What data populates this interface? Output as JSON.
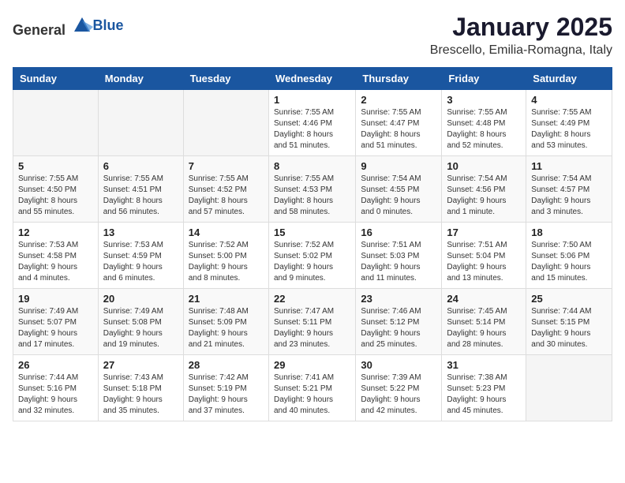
{
  "logo": {
    "text_general": "General",
    "text_blue": "Blue"
  },
  "header": {
    "month": "January 2025",
    "location": "Brescello, Emilia-Romagna, Italy"
  },
  "weekdays": [
    "Sunday",
    "Monday",
    "Tuesday",
    "Wednesday",
    "Thursday",
    "Friday",
    "Saturday"
  ],
  "weeks": [
    [
      {
        "day": "",
        "info": ""
      },
      {
        "day": "",
        "info": ""
      },
      {
        "day": "",
        "info": ""
      },
      {
        "day": "1",
        "info": "Sunrise: 7:55 AM\nSunset: 4:46 PM\nDaylight: 8 hours\nand 51 minutes."
      },
      {
        "day": "2",
        "info": "Sunrise: 7:55 AM\nSunset: 4:47 PM\nDaylight: 8 hours\nand 51 minutes."
      },
      {
        "day": "3",
        "info": "Sunrise: 7:55 AM\nSunset: 4:48 PM\nDaylight: 8 hours\nand 52 minutes."
      },
      {
        "day": "4",
        "info": "Sunrise: 7:55 AM\nSunset: 4:49 PM\nDaylight: 8 hours\nand 53 minutes."
      }
    ],
    [
      {
        "day": "5",
        "info": "Sunrise: 7:55 AM\nSunset: 4:50 PM\nDaylight: 8 hours\nand 55 minutes."
      },
      {
        "day": "6",
        "info": "Sunrise: 7:55 AM\nSunset: 4:51 PM\nDaylight: 8 hours\nand 56 minutes."
      },
      {
        "day": "7",
        "info": "Sunrise: 7:55 AM\nSunset: 4:52 PM\nDaylight: 8 hours\nand 57 minutes."
      },
      {
        "day": "8",
        "info": "Sunrise: 7:55 AM\nSunset: 4:53 PM\nDaylight: 8 hours\nand 58 minutes."
      },
      {
        "day": "9",
        "info": "Sunrise: 7:54 AM\nSunset: 4:55 PM\nDaylight: 9 hours\nand 0 minutes."
      },
      {
        "day": "10",
        "info": "Sunrise: 7:54 AM\nSunset: 4:56 PM\nDaylight: 9 hours\nand 1 minute."
      },
      {
        "day": "11",
        "info": "Sunrise: 7:54 AM\nSunset: 4:57 PM\nDaylight: 9 hours\nand 3 minutes."
      }
    ],
    [
      {
        "day": "12",
        "info": "Sunrise: 7:53 AM\nSunset: 4:58 PM\nDaylight: 9 hours\nand 4 minutes."
      },
      {
        "day": "13",
        "info": "Sunrise: 7:53 AM\nSunset: 4:59 PM\nDaylight: 9 hours\nand 6 minutes."
      },
      {
        "day": "14",
        "info": "Sunrise: 7:52 AM\nSunset: 5:00 PM\nDaylight: 9 hours\nand 8 minutes."
      },
      {
        "day": "15",
        "info": "Sunrise: 7:52 AM\nSunset: 5:02 PM\nDaylight: 9 hours\nand 9 minutes."
      },
      {
        "day": "16",
        "info": "Sunrise: 7:51 AM\nSunset: 5:03 PM\nDaylight: 9 hours\nand 11 minutes."
      },
      {
        "day": "17",
        "info": "Sunrise: 7:51 AM\nSunset: 5:04 PM\nDaylight: 9 hours\nand 13 minutes."
      },
      {
        "day": "18",
        "info": "Sunrise: 7:50 AM\nSunset: 5:06 PM\nDaylight: 9 hours\nand 15 minutes."
      }
    ],
    [
      {
        "day": "19",
        "info": "Sunrise: 7:49 AM\nSunset: 5:07 PM\nDaylight: 9 hours\nand 17 minutes."
      },
      {
        "day": "20",
        "info": "Sunrise: 7:49 AM\nSunset: 5:08 PM\nDaylight: 9 hours\nand 19 minutes."
      },
      {
        "day": "21",
        "info": "Sunrise: 7:48 AM\nSunset: 5:09 PM\nDaylight: 9 hours\nand 21 minutes."
      },
      {
        "day": "22",
        "info": "Sunrise: 7:47 AM\nSunset: 5:11 PM\nDaylight: 9 hours\nand 23 minutes."
      },
      {
        "day": "23",
        "info": "Sunrise: 7:46 AM\nSunset: 5:12 PM\nDaylight: 9 hours\nand 25 minutes."
      },
      {
        "day": "24",
        "info": "Sunrise: 7:45 AM\nSunset: 5:14 PM\nDaylight: 9 hours\nand 28 minutes."
      },
      {
        "day": "25",
        "info": "Sunrise: 7:44 AM\nSunset: 5:15 PM\nDaylight: 9 hours\nand 30 minutes."
      }
    ],
    [
      {
        "day": "26",
        "info": "Sunrise: 7:44 AM\nSunset: 5:16 PM\nDaylight: 9 hours\nand 32 minutes."
      },
      {
        "day": "27",
        "info": "Sunrise: 7:43 AM\nSunset: 5:18 PM\nDaylight: 9 hours\nand 35 minutes."
      },
      {
        "day": "28",
        "info": "Sunrise: 7:42 AM\nSunset: 5:19 PM\nDaylight: 9 hours\nand 37 minutes."
      },
      {
        "day": "29",
        "info": "Sunrise: 7:41 AM\nSunset: 5:21 PM\nDaylight: 9 hours\nand 40 minutes."
      },
      {
        "day": "30",
        "info": "Sunrise: 7:39 AM\nSunset: 5:22 PM\nDaylight: 9 hours\nand 42 minutes."
      },
      {
        "day": "31",
        "info": "Sunrise: 7:38 AM\nSunset: 5:23 PM\nDaylight: 9 hours\nand 45 minutes."
      },
      {
        "day": "",
        "info": ""
      }
    ]
  ]
}
